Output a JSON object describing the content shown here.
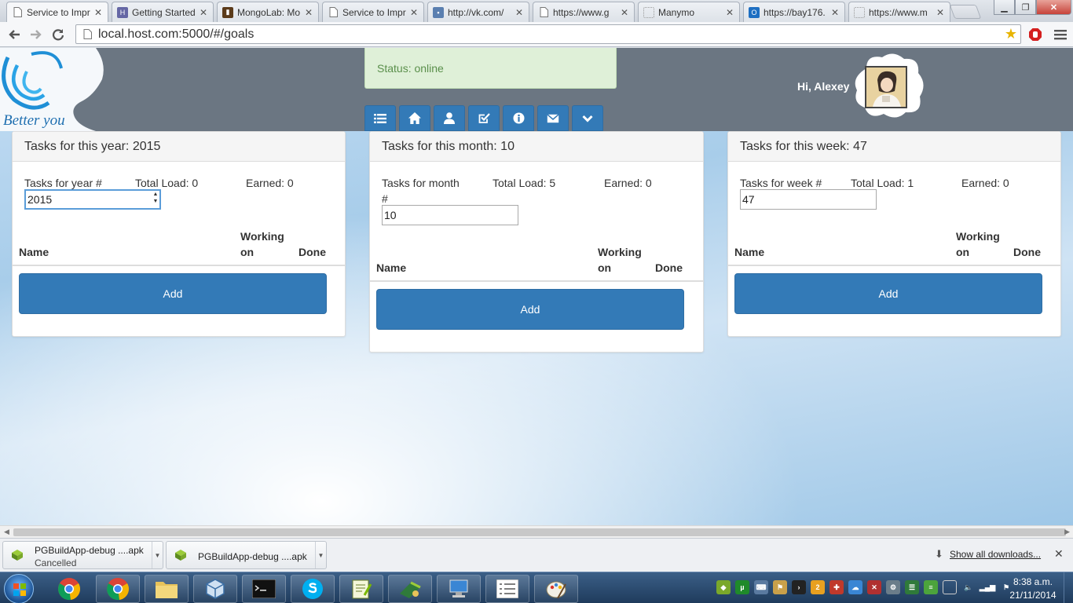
{
  "browser": {
    "tabs": [
      {
        "title": "Service to Impr",
        "active": true,
        "icon": "page-icon"
      },
      {
        "title": "Getting Started",
        "active": false,
        "icon": "heroku-icon"
      },
      {
        "title": "MongoLab: Mo",
        "active": false,
        "icon": "mongolab-icon"
      },
      {
        "title": "Service to Impr",
        "active": false,
        "icon": "page-icon"
      },
      {
        "title": "http://vk.com/",
        "active": false,
        "icon": "vk-icon"
      },
      {
        "title": "https://www.g",
        "active": false,
        "icon": "page-icon"
      },
      {
        "title": "Manymo",
        "active": false,
        "icon": "manymo-icon"
      },
      {
        "title": "https://bay176.",
        "active": false,
        "icon": "outlook-icon"
      },
      {
        "title": "https://www.m",
        "active": false,
        "icon": "page-icon"
      }
    ],
    "url": "local.host.com:5000/#/goals"
  },
  "header": {
    "logo_text": "Better you",
    "status": "Status: online",
    "greeting": "Hi, Alexey",
    "nav_buttons": [
      "list-icon",
      "home-icon",
      "user-icon",
      "check-square-icon",
      "info-icon",
      "envelope-icon",
      "chevron-down-icon"
    ]
  },
  "panels": {
    "year": {
      "title": "Tasks for this year: 2015",
      "number_label": "Tasks for year #",
      "total_load": "Total Load: 0",
      "earned": "Earned: 0",
      "input_value": "2015",
      "col_name": "Name",
      "col_working_1": "Working",
      "col_working_2": "on",
      "col_done": "Done",
      "add_label": "Add"
    },
    "month": {
      "title": "Tasks for this month: 10",
      "number_label_1": "Tasks for month",
      "number_label_2": "#",
      "total_load": "Total Load: 5",
      "earned": "Earned: 0",
      "input_value": "10",
      "col_name": "Name",
      "col_working_1": "Working",
      "col_working_2": "on",
      "col_done": "Done",
      "add_label": "Add"
    },
    "week": {
      "title": "Tasks for this week: 47",
      "number_label": "Tasks for week #",
      "total_load": "Total Load: 1",
      "earned": "Earned: 0",
      "input_value": "47",
      "col_name": "Name",
      "col_working_1": "Working",
      "col_working_2": "on",
      "col_done": "Done",
      "add_label": "Add"
    }
  },
  "downloads": {
    "items": [
      {
        "name": "PGBuildApp-debug ....apk",
        "status": "Cancelled"
      },
      {
        "name": "PGBuildApp-debug ....apk",
        "status": ""
      }
    ],
    "show_all": "Show all downloads..."
  },
  "taskbar": {
    "time": "8:38 a.m.",
    "date": "21/11/2014"
  },
  "colors": {
    "primary": "#337ab7",
    "header": "#6b7682",
    "status_bg": "#dff0d8",
    "status_text": "#5a8f4b"
  }
}
